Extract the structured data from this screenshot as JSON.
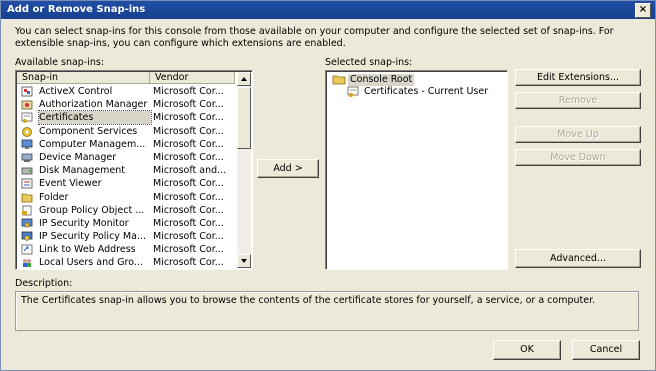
{
  "window": {
    "title": "Add or Remove Snap-ins",
    "close_glyph": "×"
  },
  "intro_text": "You can select snap-ins for this console from those available on your computer and configure the selected set of snap-ins. For extensible snap-ins, you can configure which extensions are enabled.",
  "available": {
    "label": "Available snap-ins:",
    "col_snapin": "Snap-in",
    "col_vendor": "Vendor",
    "items": [
      {
        "name": "ActiveX Control",
        "vendor": "Microsoft Cor...",
        "icon": "activex-icon"
      },
      {
        "name": "Authorization Manager",
        "vendor": "Microsoft Cor...",
        "icon": "authorization-icon"
      },
      {
        "name": "Certificates",
        "vendor": "Microsoft Cor...",
        "icon": "certificates-icon"
      },
      {
        "name": "Component Services",
        "vendor": "Microsoft Cor...",
        "icon": "component-services-icon"
      },
      {
        "name": "Computer Managem...",
        "vendor": "Microsoft Cor...",
        "icon": "computer-management-icon"
      },
      {
        "name": "Device Manager",
        "vendor": "Microsoft Cor...",
        "icon": "device-manager-icon"
      },
      {
        "name": "Disk Management",
        "vendor": "Microsoft and...",
        "icon": "disk-management-icon"
      },
      {
        "name": "Event Viewer",
        "vendor": "Microsoft Cor...",
        "icon": "event-viewer-icon"
      },
      {
        "name": "Folder",
        "vendor": "Microsoft Cor...",
        "icon": "folder-icon"
      },
      {
        "name": "Group Policy Object ...",
        "vendor": "Microsoft Cor...",
        "icon": "group-policy-icon"
      },
      {
        "name": "IP Security Monitor",
        "vendor": "Microsoft Cor...",
        "icon": "ip-security-monitor-icon"
      },
      {
        "name": "IP Security Policy Ma...",
        "vendor": "Microsoft Cor...",
        "icon": "ip-security-policy-icon"
      },
      {
        "name": "Link to Web Address",
        "vendor": "Microsoft Cor...",
        "icon": "link-icon"
      },
      {
        "name": "Local Users and Gro...",
        "vendor": "Microsoft Cor...",
        "icon": "local-users-icon"
      }
    ],
    "selected_index": 2
  },
  "add_button": "Add >",
  "selected": {
    "label": "Selected snap-ins:",
    "root": "Console Root",
    "child": "Certificates - Current User"
  },
  "buttons": {
    "edit_extensions": "Edit Extensions...",
    "remove": "Remove",
    "move_up": "Move Up",
    "move_down": "Move Down",
    "advanced": "Advanced...",
    "ok": "OK",
    "cancel": "Cancel"
  },
  "description": {
    "label": "Description:",
    "text": "The Certificates snap-in allows you to browse the contents of the certificate stores for yourself, a service, or a computer."
  }
}
